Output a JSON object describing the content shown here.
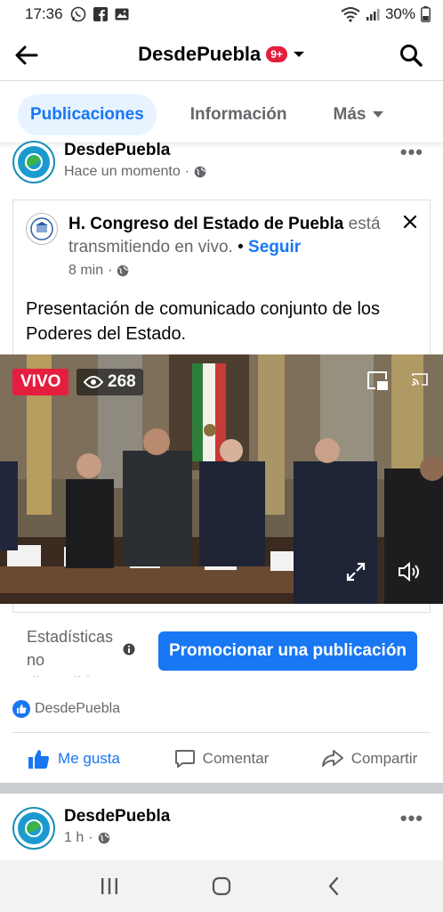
{
  "status_bar": {
    "time": "17:36",
    "battery": "30%"
  },
  "header": {
    "title": "DesdePuebla",
    "notification_badge": "9+"
  },
  "tabs": [
    {
      "label": "Publicaciones",
      "active": true
    },
    {
      "label": "Información",
      "active": false
    },
    {
      "label": "Más",
      "active": false
    }
  ],
  "post": {
    "author": "DesdePuebla",
    "time": "Hace un momento",
    "shared": {
      "page": "H. Congreso del Estado de Puebla",
      "action": " está transmitiendo en vivo.",
      "follow": "Seguir",
      "separator": "•",
      "time": "8 min",
      "caption": "Presentación de comunicado conjunto de los Poderes del Estado."
    },
    "video": {
      "live_label": "VIVO",
      "viewers": "268"
    },
    "stats_label": "Estadísticas no disponibles",
    "promote_label": "Promocionar una publicación",
    "reactions_by": "DesdePuebla",
    "actions": {
      "like": "Me gusta",
      "comment": "Comentar",
      "share": "Compartir"
    }
  },
  "next_post": {
    "author": "DesdePuebla",
    "time": "1 h"
  },
  "colors": {
    "accent": "#1877f2",
    "live": "#e41e3f",
    "badge": "#e41e3f"
  }
}
